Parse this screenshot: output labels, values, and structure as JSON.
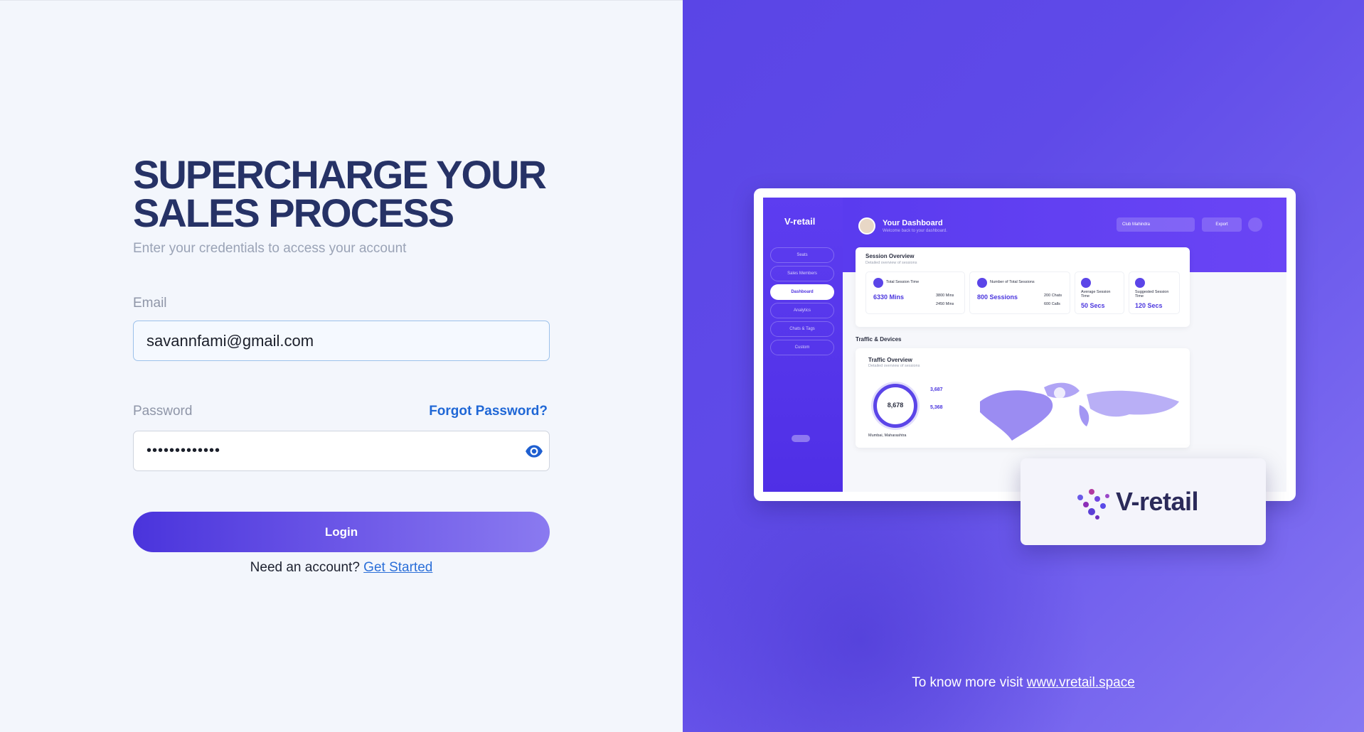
{
  "login": {
    "headline_line1": "SUPERCHARGE YOUR",
    "headline_line2": "SALES PROCESS",
    "subtitle": "Enter your credentials to access your account",
    "email_label": "Email",
    "email_value": "savannfami@gmail.com",
    "password_label": "Password",
    "forgot_password": "Forgot Password?",
    "password_value": "•••••••••••••",
    "login_button": "Login",
    "need_account": "Need an account?",
    "get_started": "Get Started"
  },
  "promo": {
    "visit_text": "To know more visit",
    "visit_link": "www.vretail.space",
    "brand_name": "V-retail",
    "mockup": {
      "logo": "V-retail",
      "nav": [
        "Seats",
        "Sales Members",
        "Dashboard",
        "Analytics",
        "Chats & Tags",
        "Custom"
      ],
      "active_nav": "Dashboard",
      "title": "Your Dashboard",
      "subtitle": "Welcome back to your dashboard.",
      "select": "Club Mahindra",
      "export": "Export",
      "session_overview": "Session Overview",
      "session_overview_sub": "Detailed overview of sessions",
      "stats": [
        {
          "label": "Total Session Time",
          "value": "6330 Mins"
        },
        {
          "label": "Number of Total Sessions",
          "value": "800 Sessions"
        },
        {
          "label": "Average Session Time",
          "value": "50 Secs"
        },
        {
          "label": "Suggested Session Time",
          "value": "120 Secs"
        }
      ],
      "side_values": [
        "3800 Mins",
        "2450 Mins",
        "200 Chats",
        "600 Calls"
      ],
      "traffic_devices": "Traffic & Devices",
      "traffic_overview": "Traffic Overview",
      "traffic_overview_sub": "Detailed overview of sessions",
      "ring_value": "8,678",
      "traffic_values": [
        "3,687",
        "5,368"
      ],
      "location": "Mumbai, Maharashtra"
    }
  },
  "colors": {
    "headline": "#263266",
    "link": "#1f67d6",
    "accent": "#5a45e6"
  }
}
